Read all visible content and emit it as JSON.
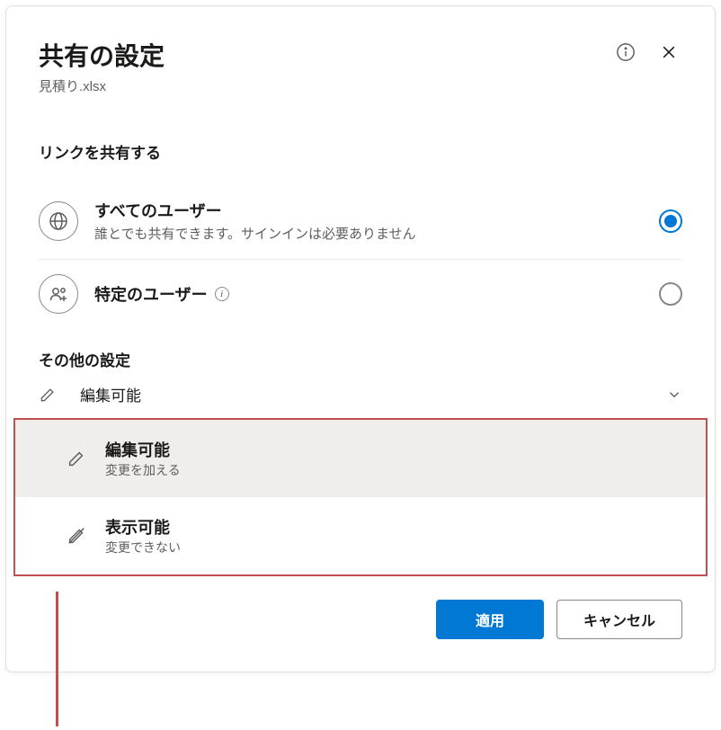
{
  "colors": {
    "accent": "#0078d4",
    "callout": "#c0504d"
  },
  "header": {
    "title": "共有の設定",
    "filename": "見積り.xlsx"
  },
  "share": {
    "section_label": "リンクを共有する",
    "options": [
      {
        "title": "すべてのユーザー",
        "desc": "誰とでも共有できます。サインインは必要ありません",
        "icon": "globe-icon",
        "selected": true
      },
      {
        "title": "特定のユーザー",
        "desc": "",
        "icon": "people-add-icon",
        "selected": false,
        "has_info": true
      }
    ]
  },
  "other": {
    "section_label": "その他の設定",
    "current": "編集可能",
    "menu": [
      {
        "title": "編集可能",
        "desc": "変更を加える",
        "icon": "pencil-icon",
        "selected": true
      },
      {
        "title": "表示可能",
        "desc": "変更できない",
        "icon": "pencil-slash-icon",
        "selected": false
      }
    ]
  },
  "buttons": {
    "apply": "適用",
    "cancel": "キャンセル"
  }
}
